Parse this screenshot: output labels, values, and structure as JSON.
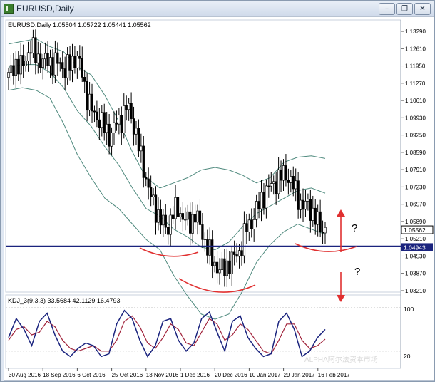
{
  "window": {
    "title": "EURUSD,Daily",
    "buttons": [
      "minimize",
      "restore",
      "close"
    ]
  },
  "main_panel": {
    "info_label": "EURUSD,Daily  1.05504 1.05722 1.05441 1.05562"
  },
  "indicator": {
    "label": "KDJ_3(9,3,3) 33.5684 42.1129 16.4793",
    "levels": [
      "100",
      "20"
    ]
  },
  "price_axis": [
    "1.13290",
    "1.12610",
    "1.11950",
    "1.11270",
    "1.10610",
    "1.09930",
    "1.09250",
    "1.08590",
    "1.07910",
    "1.07230",
    "1.06570",
    "1.05890",
    "1.05210",
    "1.04530",
    "1.03870",
    "1.03210"
  ],
  "price_markers": {
    "current": "1.05562",
    "line": "1.04943"
  },
  "time_axis": [
    "30 Aug 2016",
    "18 Sep 2016",
    "6 Oct 2016",
    "25 Oct 2016",
    "13 Nov 2016",
    "1 Dec 2016",
    "20 Dec 2016",
    "10 Jan 2017",
    "29 Jan 2017",
    "16 Feb 2017"
  ],
  "annotations": {
    "q_up": "?",
    "q_down": "?"
  },
  "watermark": "ALPHA阿尔法资本市场",
  "colors": {
    "candle": "#000000",
    "bands": "#4f8a7e",
    "horizontal_line": "#1a237e",
    "k_line": "#1a237e",
    "d_line": "#a0223a",
    "annotation": "#e03030"
  },
  "chart_data": {
    "type": "candlestick",
    "symbol": "EURUSD",
    "timeframe": "Daily",
    "ohlc_last": {
      "open": 1.05504,
      "high": 1.05722,
      "low": 1.05441,
      "close": 1.05562
    },
    "close_path": [
      1.115,
      1.121,
      1.118,
      1.123,
      1.126,
      1.124,
      1.12,
      1.123,
      1.119,
      1.122,
      1.117,
      1.121,
      1.123,
      1.117,
      1.106,
      1.101,
      1.099,
      1.095,
      1.092,
      1.097,
      1.099,
      1.104,
      1.098,
      1.088,
      1.079,
      1.069,
      1.064,
      1.059,
      1.056,
      1.062,
      1.064,
      1.06,
      1.058,
      1.062,
      1.056,
      1.05,
      1.044,
      1.041,
      1.04,
      1.043,
      1.045,
      1.048,
      1.056,
      1.059,
      1.064,
      1.069,
      1.072,
      1.074,
      1.076,
      1.078,
      1.074,
      1.07,
      1.064,
      1.066,
      1.061,
      1.057,
      1.056
    ],
    "upper_band": [
      1.128,
      1.129,
      1.13,
      1.127,
      1.125,
      1.119,
      1.116,
      1.108,
      1.098,
      1.086,
      1.076,
      1.072,
      1.074,
      1.076,
      1.079,
      1.08,
      1.079,
      1.077,
      1.074,
      1.076,
      1.082,
      1.084,
      1.0845,
      1.0835
    ],
    "middle_band": [
      1.119,
      1.12,
      1.12,
      1.117,
      1.111,
      1.102,
      1.096,
      1.088,
      1.081,
      1.072,
      1.064,
      1.061,
      1.056,
      1.053,
      1.049,
      1.048,
      1.051,
      1.057,
      1.062,
      1.065,
      1.068,
      1.071,
      1.072,
      1.07
    ],
    "lower_band": [
      1.11,
      1.111,
      1.11,
      1.107,
      1.097,
      1.085,
      1.076,
      1.068,
      1.064,
      1.058,
      1.052,
      1.048,
      1.038,
      1.03,
      1.023,
      1.021,
      1.023,
      1.032,
      1.043,
      1.05,
      1.055,
      1.058,
      1.056,
      1.054
    ],
    "kdj_k": [
      45,
      80,
      60,
      30,
      75,
      90,
      50,
      20,
      10,
      25,
      35,
      30,
      10,
      15,
      70,
      95,
      80,
      40,
      10,
      30,
      75,
      80,
      40,
      20,
      35,
      80,
      92,
      55,
      20,
      75,
      85,
      45,
      25,
      10,
      15,
      75,
      90,
      60,
      10,
      20,
      45,
      60
    ],
    "kdj_d": [
      40,
      60,
      65,
      50,
      55,
      75,
      65,
      40,
      25,
      20,
      25,
      30,
      20,
      20,
      40,
      75,
      85,
      65,
      35,
      25,
      45,
      70,
      60,
      35,
      30,
      55,
      80,
      70,
      40,
      50,
      70,
      60,
      40,
      20,
      15,
      40,
      70,
      70,
      40,
      25,
      30,
      42
    ],
    "indicator_levels": [
      100,
      20
    ],
    "ylim": [
      1.0321,
      1.1329
    ]
  }
}
